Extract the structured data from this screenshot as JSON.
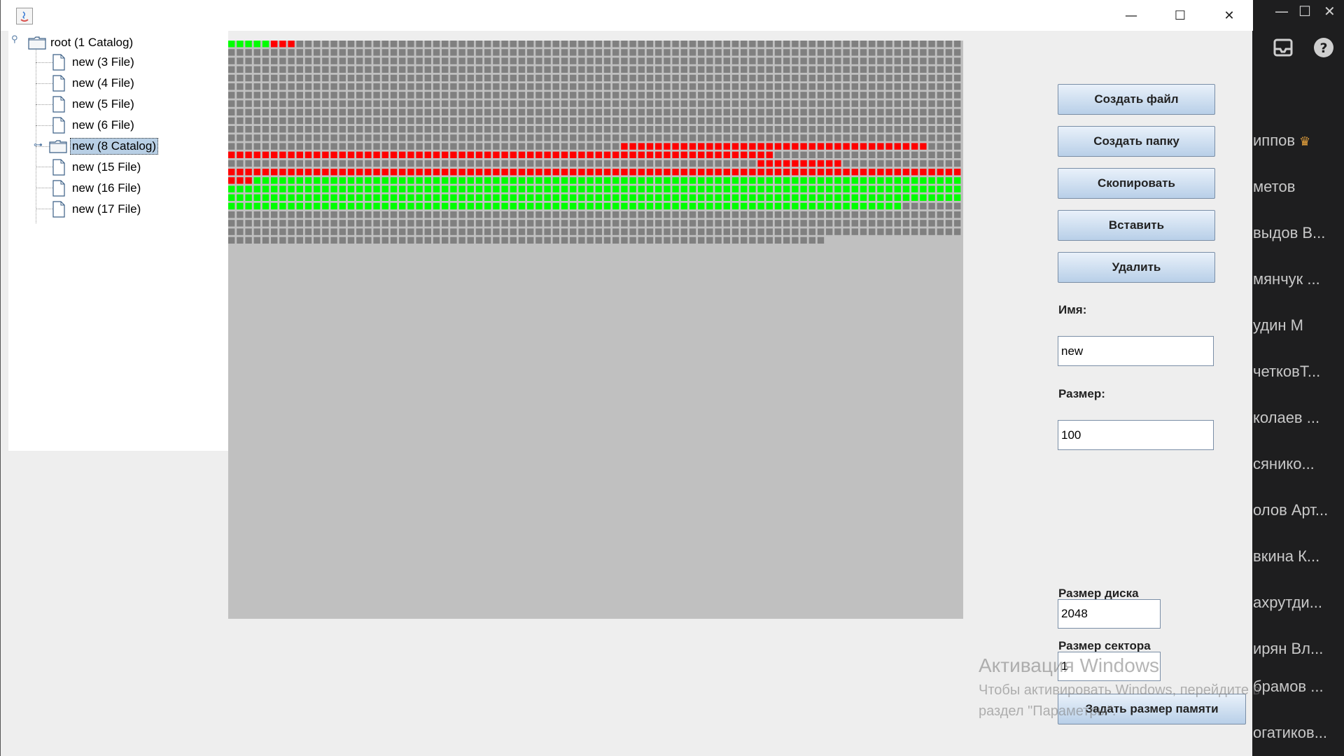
{
  "window": {
    "title_controls": {
      "minimize": "—",
      "maximize": "☐",
      "close": "✕"
    }
  },
  "tree": {
    "root": {
      "label": "root (1 Catalog)"
    },
    "items": [
      {
        "label": "new (3 File)",
        "type": "file"
      },
      {
        "label": "new (4 File)",
        "type": "file"
      },
      {
        "label": "new (5 File)",
        "type": "file"
      },
      {
        "label": "new (6 File)",
        "type": "file"
      },
      {
        "label": "new (8 Catalog)",
        "type": "folder",
        "selected": true
      },
      {
        "label": "new (15 File)",
        "type": "file"
      },
      {
        "label": "new (16 File)",
        "type": "file"
      },
      {
        "label": "new (17 File)",
        "type": "file"
      }
    ]
  },
  "memory_map": {
    "total_sectors": 2048,
    "columns": 86,
    "colors": {
      "free": "#808080",
      "used": "#ff0000",
      "selected": "#00ff00",
      "background": "#c0c0c0"
    },
    "runs": [
      {
        "start": 0,
        "count": 5,
        "state": "selected"
      },
      {
        "start": 5,
        "count": 3,
        "state": "used"
      },
      {
        "start": 1078,
        "count": 36,
        "state": "used"
      },
      {
        "start": 1118,
        "count": 64,
        "state": "used"
      },
      {
        "start": 1266,
        "count": 10,
        "state": "used"
      },
      {
        "start": 1290,
        "count": 89,
        "state": "used"
      },
      {
        "start": 1379,
        "count": 334,
        "state": "selected"
      }
    ]
  },
  "controls": {
    "create_file": "Создать файл",
    "create_folder": "Создать папку",
    "copy": "Скопировать",
    "paste": "Вставить",
    "delete": "Удалить",
    "name_label": "Имя:",
    "name_value": "new",
    "size_label": "Размер:",
    "size_value": "100",
    "disk_size_label": "Размер диска",
    "disk_size_value": "2048",
    "sector_size_label": "Размер сектора",
    "sector_size_value": "1",
    "set_memory": "Задать размер памяти"
  },
  "watermark": {
    "title": "Активация Windows",
    "line1": "Чтобы активировать Windows, перейдите в",
    "line2": "раздел \"Параметры\"."
  },
  "background_app": {
    "controls": {
      "minimize": "—",
      "maximize": "☐",
      "close": "✕"
    },
    "items": [
      "иппов",
      "метов",
      "выдов В...",
      "мянчук ...",
      "удин М",
      "четковТ...",
      "колаев ...",
      "сянико...",
      "олов Арт...",
      "вкина К...",
      "ахрутди...",
      "ирян Вл...",
      "брамов ...",
      "огатиков..."
    ],
    "crown_icon": "crown-icon",
    "accent_color": "#e8a33d"
  }
}
